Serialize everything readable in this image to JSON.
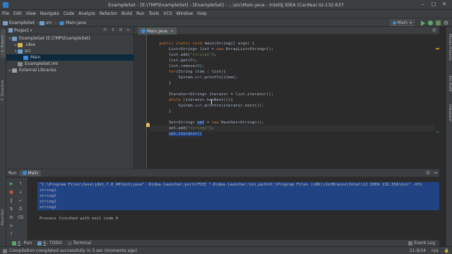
{
  "window": {
    "title": "ExampleSet - [E:\\TMP\\ExampleSet] - [ExampleSet] - ...\\src\\Main.java - IntelliJ IDEA (Cardea) IU-132.637",
    "controls": [
      "–",
      "□",
      "✕"
    ]
  },
  "menu": [
    "File",
    "Edit",
    "View",
    "Navigate",
    "Code",
    "Analyze",
    "Refactor",
    "Build",
    "Run",
    "Tools",
    "VCS",
    "Window",
    "Help"
  ],
  "navbar": {
    "breadcrumbs": [
      "ExampleSet",
      "src",
      "Main.java"
    ],
    "run_config": "Main"
  },
  "project_panel": {
    "header": "Project",
    "tree": [
      {
        "label": "ExampleSet (E:\\TMP\\ExampleSet)",
        "depth": 0,
        "icon": "module-icon",
        "expanded": true
      },
      {
        "label": ".idea",
        "depth": 1,
        "icon": "folder-icon",
        "expanded": false
      },
      {
        "label": "src",
        "depth": 1,
        "icon": "src-folder-icon",
        "expanded": true
      },
      {
        "label": "Main",
        "depth": 2,
        "icon": "class-icon",
        "selected": true
      },
      {
        "label": "ExampleSet.iml",
        "depth": 1,
        "icon": "file-icon"
      },
      {
        "label": "External Libraries",
        "depth": 0,
        "icon": "library-icon",
        "expanded": false
      }
    ]
  },
  "left_strip": [
    "1: Project",
    "7: Structure",
    "Favorites"
  ],
  "right_strip": [
    "Maven Projects",
    "Ant Build",
    "Database"
  ],
  "editor": {
    "tab": "Main.java",
    "lines": [
      [
        {
          "t": "    "
        },
        {
          "t": "public static void ",
          "c": "kw"
        },
        {
          "t": "main(String[] args) {"
        }
      ],
      [
        {
          "t": "        List<String> list = "
        },
        {
          "t": "new ",
          "c": "kw"
        },
        {
          "t": "ArrayList<String>();"
        }
      ],
      [
        {
          "t": "        list.add("
        },
        {
          "t": "\"string1\"",
          "c": "str"
        },
        {
          "t": ");"
        }
      ],
      [
        {
          "t": "        list.get("
        },
        {
          "t": "0",
          "c": "num"
        },
        {
          "t": ");"
        }
      ],
      [
        {
          "t": "        list.remove("
        },
        {
          "t": "0",
          "c": "num"
        },
        {
          "t": ");"
        }
      ],
      [
        {
          "t": "        "
        },
        {
          "t": "for",
          "c": "kw"
        },
        {
          "t": "(String item : list){"
        }
      ],
      [
        {
          "t": "            System."
        },
        {
          "t": "out",
          "c": "fld"
        },
        {
          "t": ".println(item);"
        }
      ],
      [
        {
          "t": "        }"
        }
      ],
      [
        {
          "t": ""
        }
      ],
      [
        {
          "t": "        Iterator<String> iterator = list.iterator();"
        }
      ],
      [
        {
          "t": "        "
        },
        {
          "t": "while",
          "c": "kw"
        },
        {
          "t": " (iterator.hasNext()){"
        }
      ],
      [
        {
          "t": "            System."
        },
        {
          "t": "out",
          "c": "fld"
        },
        {
          "t": ".println(iterator.next());"
        }
      ],
      [
        {
          "t": "        }"
        }
      ],
      [
        {
          "t": ""
        }
      ],
      [
        {
          "t": "        Set<String> "
        },
        {
          "t": "set",
          "c": "sel"
        },
        {
          "t": " = "
        },
        {
          "t": "new ",
          "c": "kw"
        },
        {
          "t": "HashSet<String>();"
        }
      ],
      [
        {
          "t": "        set.add("
        },
        {
          "t": "\"string1\"",
          "c": "str"
        },
        {
          "t": ");"
        }
      ],
      [
        {
          "t": "        "
        },
        {
          "t": "set.iterator()",
          "c": "sel"
        }
      ]
    ]
  },
  "run_panel": {
    "label": "Run",
    "tab": "Main",
    "lines": [
      "\"C:\\Program Files\\Java\\jdk1.7.0_40\\bin\\java\" -Didea.launcher.port=7533 \"-Didea.launcher.bin.path=C:\\Program Files (x86)\\JetBrains\\IntelliJ IDEA 132.556\\bin\" -Dfi",
      "string1",
      "string1",
      "string1",
      "string1",
      "",
      "Process finished with exit code 0"
    ],
    "highlighted_lines": [
      0,
      1,
      2,
      3,
      4
    ]
  },
  "bottom": {
    "tabs": [
      {
        "num": "4",
        "label": ": Run"
      },
      {
        "num": "6",
        "label": ": TODO"
      },
      {
        "num": "",
        "label": "Terminal"
      }
    ],
    "event_log": "Event Log",
    "status": "Compilation completed successfully in 3 sec (moments ago)",
    "position": "21:9/14",
    "encoding": "n/a",
    "colors": {
      "accent": "#214283",
      "run_green": "#59a869"
    }
  }
}
